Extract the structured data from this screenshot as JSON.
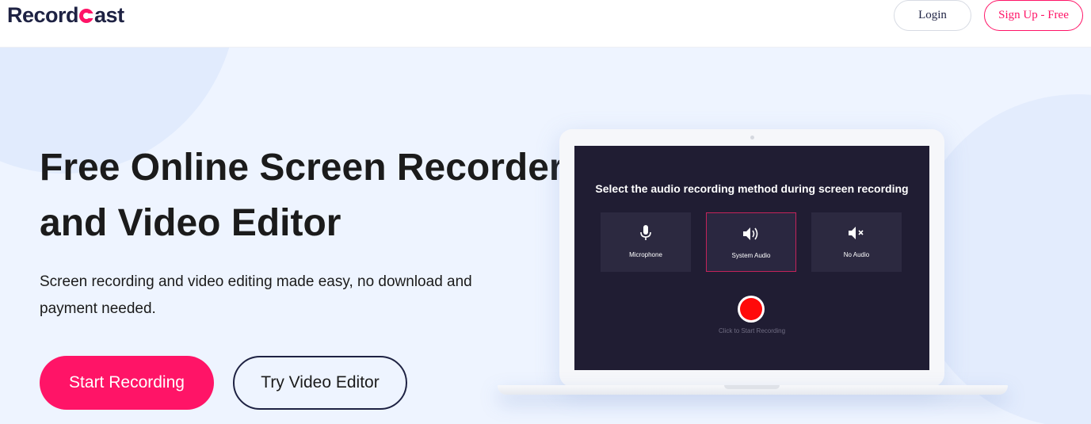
{
  "header": {
    "logo_text_before": "Record",
    "logo_text_after": "ast",
    "login_label": "Login",
    "signup_label": "Sign Up - Free"
  },
  "hero": {
    "title": "Free Online Screen Recorder and Video Editor",
    "subtitle": "Screen recording and video editing made easy, no download and payment needed.",
    "start_label": "Start Recording",
    "editor_label": "Try Video Editor"
  },
  "laptop_screen": {
    "heading": "Select the audio recording method during screen recording",
    "options": [
      {
        "label": "Microphone",
        "icon": "microphone-icon",
        "selected": false
      },
      {
        "label": "System Audio",
        "icon": "speaker-icon",
        "selected": true
      },
      {
        "label": "No Audio",
        "icon": "speaker-muted-icon",
        "selected": false
      }
    ],
    "record_hint": "Click to Start Recording"
  },
  "colors": {
    "brand": "#ff1467",
    "navy": "#1e2243",
    "hero_bg": "#eef4ff",
    "screen_bg": "#201d33",
    "record_red": "#ff0a0a"
  }
}
